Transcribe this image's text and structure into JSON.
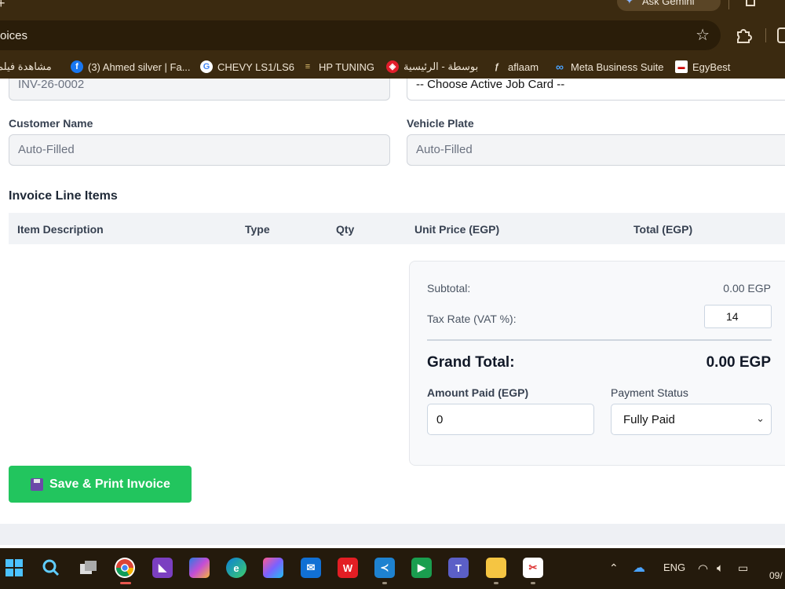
{
  "browser": {
    "gemini_label": "Ask Gemini",
    "url_text": "oices",
    "bookmarks": [
      {
        "label": "مشاهدة فيلم",
        "icon": "film-icon"
      },
      {
        "label": "(3) Ahmed silver | Fa...",
        "icon": "facebook-icon"
      },
      {
        "label": "CHEVY LS1/LS6",
        "icon": "google-icon"
      },
      {
        "label": "HP TUNING",
        "icon": "hp-tuning-icon"
      },
      {
        "label": "بوسطة - الرئيسية",
        "icon": "bosta-icon"
      },
      {
        "label": "aflaam",
        "icon": "aflaam-icon"
      },
      {
        "label": "Meta Business Suite",
        "icon": "meta-icon"
      },
      {
        "label": "EgyBest",
        "icon": "egybest-icon"
      }
    ]
  },
  "form": {
    "invoice_no_value": "INV-26-0002",
    "job_card_value": "-- Choose Active Job Card --",
    "customer_name_label": "Customer Name",
    "customer_name_placeholder": "Auto-Filled",
    "vehicle_plate_label": "Vehicle Plate",
    "vehicle_plate_placeholder": "Auto-Filled"
  },
  "line_items": {
    "title": "Invoice Line Items",
    "columns": [
      "Item Description",
      "Type",
      "Qty",
      "Unit Price (EGP)",
      "Total (EGP)"
    ]
  },
  "summary": {
    "subtotal_label": "Subtotal:",
    "subtotal_value": "0.00 EGP",
    "tax_label": "Tax Rate (VAT %):",
    "tax_value": "14",
    "grand_total_label": "Grand Total:",
    "grand_total_value": "0.00 EGP",
    "amount_paid_label": "Amount Paid (EGP)",
    "amount_paid_value": "0",
    "payment_status_label": "Payment Status",
    "payment_status_value": "Fully Paid"
  },
  "actions": {
    "save_label": "Save & Print Invoice"
  },
  "taskbar": {
    "language": "ENG",
    "date_fragment": "09/"
  },
  "colors": {
    "primary_green": "#22c55e",
    "browser_brown": "#3b2a10"
  }
}
